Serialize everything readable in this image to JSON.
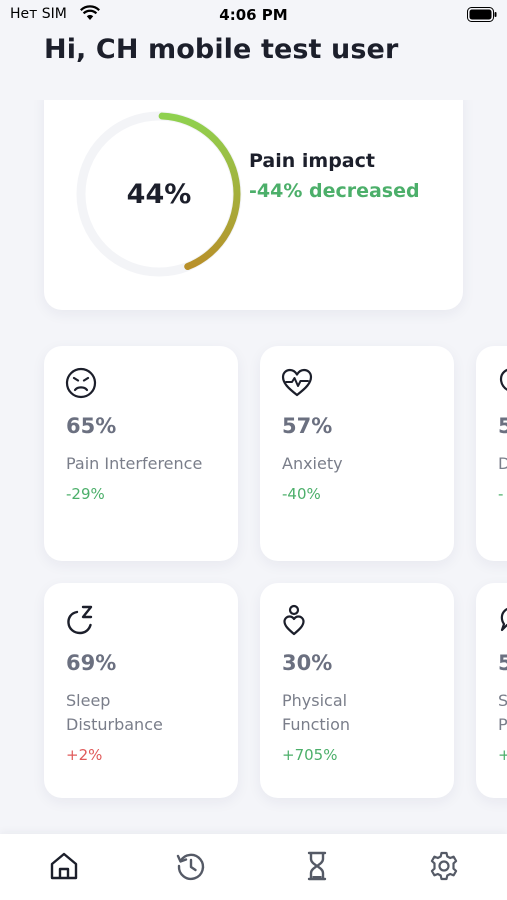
{
  "status_bar": {
    "carrier": "Нет SIM",
    "time": "4:06 PM"
  },
  "greeting": "Hi, CH mobile test user",
  "pain_card": {
    "value": "44%",
    "level": 0.44,
    "title": "Pain impact",
    "change": "-44% decreased",
    "ring_colors": [
      "#8fd14f",
      "#b8902a"
    ]
  },
  "metrics": [
    {
      "icon": "frown-face-icon",
      "value": "65%",
      "label": "Pain Interference",
      "change": "-29%",
      "trend": "down"
    },
    {
      "icon": "heart-pulse-icon",
      "value": "57%",
      "label": "Anxiety",
      "change": "-40%",
      "trend": "down"
    },
    {
      "icon": "head-icon",
      "value": "5",
      "label": "D",
      "change": "-",
      "trend": "down"
    },
    {
      "icon": "sleep-icon",
      "value": "69%",
      "label_line1": "Sleep",
      "label_line2": "Disturbance",
      "change": "+2%",
      "trend": "up-bad"
    },
    {
      "icon": "person-heart-icon",
      "value": "30%",
      "label_line1": "Physical",
      "label_line2": "Function",
      "change": "+705%",
      "trend": "up-good"
    },
    {
      "icon": "chat-icon",
      "value": "5",
      "label_line1": "S",
      "label_line2": "P",
      "change": "+",
      "trend": "up-good"
    }
  ],
  "tab_bar": {
    "tabs": [
      "home-tab",
      "history-tab",
      "assessment-tab",
      "settings-tab"
    ]
  },
  "colors": {
    "green": "#4caf6a",
    "red": "#e05a5a",
    "background": "#f4f5f9"
  }
}
